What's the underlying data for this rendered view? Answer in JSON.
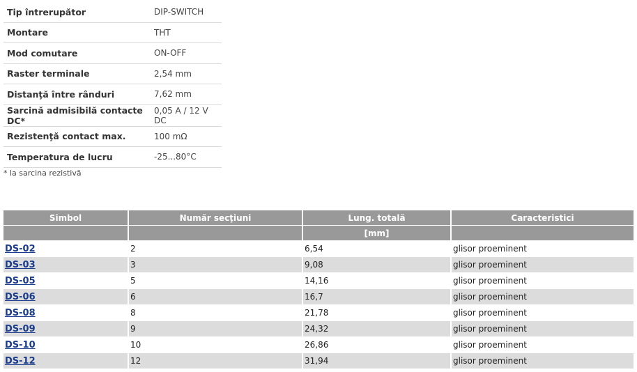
{
  "specs": [
    {
      "label": "Tip întrerupător",
      "value": "DIP-SWITCH"
    },
    {
      "label": "Montare",
      "value": "THT"
    },
    {
      "label": "Mod comutare",
      "value": "ON-OFF"
    },
    {
      "label": "Raster terminale",
      "value": "2,54 mm"
    },
    {
      "label": "Distanţă între rânduri",
      "value": "7,62 mm"
    },
    {
      "label": "Sarcină admisibilă contacte DC*",
      "value": "0,05 A / 12 V DC"
    },
    {
      "label": "Rezistenţă contact max.",
      "value": "100 mΩ"
    },
    {
      "label": "Temperatura de lucru",
      "value": "-25...80°C"
    }
  ],
  "note": "* la sarcina rezistivă",
  "table": {
    "headers": [
      "Simbol",
      "Număr secţiuni",
      "Lung. totală",
      "Caracteristici"
    ],
    "units": [
      "",
      "",
      "[mm]",
      ""
    ],
    "rows": [
      {
        "symbol": "DS-02",
        "sections": "2",
        "length": "6,54",
        "feature": "glisor proeminent"
      },
      {
        "symbol": "DS-03",
        "sections": "3",
        "length": "9,08",
        "feature": "glisor proeminent"
      },
      {
        "symbol": "DS-05",
        "sections": "5",
        "length": "14,16",
        "feature": "glisor proeminent"
      },
      {
        "symbol": "DS-06",
        "sections": "6",
        "length": "16,7",
        "feature": "glisor proeminent"
      },
      {
        "symbol": "DS-08",
        "sections": "8",
        "length": "21,78",
        "feature": "glisor proeminent"
      },
      {
        "symbol": "DS-09",
        "sections": "9",
        "length": "24,32",
        "feature": "glisor proeminent"
      },
      {
        "symbol": "DS-10",
        "sections": "10",
        "length": "26,86",
        "feature": "glisor proeminent"
      },
      {
        "symbol": "DS-12",
        "sections": "12",
        "length": "31,94",
        "feature": "glisor proeminent"
      }
    ]
  }
}
